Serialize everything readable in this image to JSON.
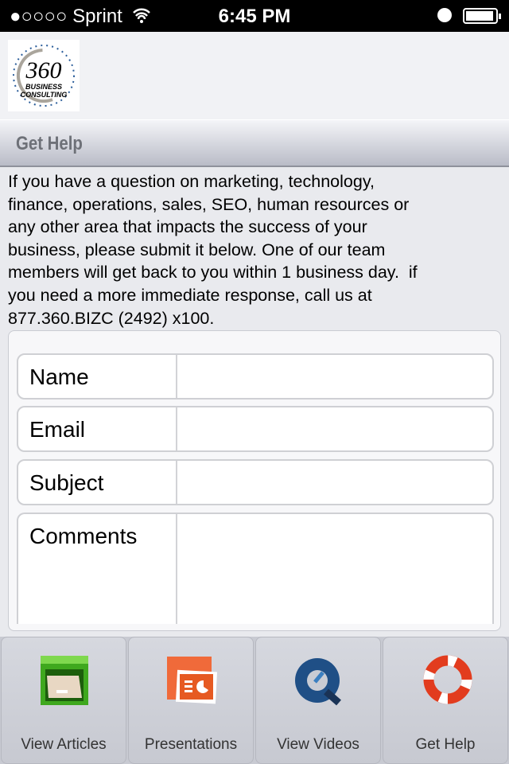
{
  "status": {
    "carrier": "●○○○○ Sprint",
    "time": "6:45 PM"
  },
  "header": {
    "logo_text": "360 Business Consulting"
  },
  "title_bar": {
    "title": "Get Help"
  },
  "description": [
    "If you have a question on marketing, technology,",
    "finance, operations, sales, SEO, human resources or",
    "any other area that impacts the success of your",
    "business, please submit it below. One of our team",
    "members will get back to you within 1 business day.  if",
    "you need a more immediate response, call us at",
    "877.360.BIZC (2492) x100."
  ],
  "form": {
    "fields": [
      {
        "label": "Name",
        "value": ""
      },
      {
        "label": "Email",
        "value": ""
      },
      {
        "label": "Subject",
        "value": ""
      },
      {
        "label": "Comments",
        "value": ""
      }
    ]
  },
  "tabs": [
    {
      "label": "View Articles",
      "icon": "file-drawer-icon"
    },
    {
      "label": "Presentations",
      "icon": "powerpoint-icon"
    },
    {
      "label": "View Videos",
      "icon": "quicktime-icon"
    },
    {
      "label": "Get Help",
      "icon": "lifebuoy-icon"
    }
  ]
}
